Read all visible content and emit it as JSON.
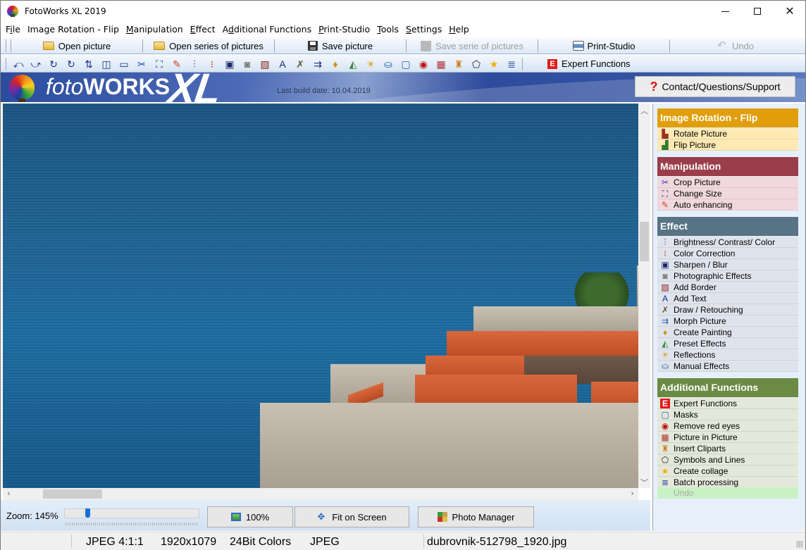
{
  "window": {
    "title": "FotoWorks XL 2019",
    "controls": {
      "minimize": "minimize",
      "maximize": "maximize",
      "close": "close"
    }
  },
  "menubar": {
    "items": [
      {
        "label": "File",
        "underline": "i"
      },
      {
        "label": "Image Rotation - Flip",
        "underline": "g"
      },
      {
        "label": "Manipulation",
        "underline": "M"
      },
      {
        "label": "Effect",
        "underline": "E"
      },
      {
        "label": "Additional Functions",
        "underline": "d"
      },
      {
        "label": "Print-Studio",
        "underline": "P"
      },
      {
        "label": "Tools",
        "underline": "T"
      },
      {
        "label": "Settings",
        "underline": "S"
      },
      {
        "label": "Help",
        "underline": "H"
      }
    ]
  },
  "toolbar": {
    "open_picture": "Open picture",
    "open_series": "Open series of pictures",
    "save_picture": "Save picture",
    "save_series": "Save serie of pictures",
    "print_studio": "Print-Studio",
    "undo": "Undo"
  },
  "icon_toolbar": {
    "icons": [
      "rotate-left-icon",
      "rotate-right-icon",
      "rotate-ccw-icon",
      "rotate-cw-icon",
      "flip-vertical-icon",
      "flip-horizontal-icon",
      "scan-icon",
      "crop-scissors-icon",
      "resize-icon",
      "magic-wand-icon",
      "brightness-sliders-icon",
      "color-correction-icon",
      "sharpen-blur-icon",
      "camera-effects-icon",
      "border-icon",
      "text-icon",
      "draw-retouch-icon",
      "morph-icon",
      "painting-pen-icon",
      "preset-effects-icon",
      "reflections-icon",
      "manual-effects-icon",
      "masks-icon",
      "red-eye-icon",
      "picture-in-picture-icon",
      "cliparts-icon",
      "symbols-lines-icon",
      "collage-star-icon",
      "batch-processing-icon"
    ],
    "expert_functions": "Expert Functions",
    "expert_badge": "E"
  },
  "brand": {
    "name_light": "foto",
    "name_bold": "WORKS",
    "suffix": "XL",
    "build_date": "Last build date: 10.04.2019",
    "support_button": "Contact/Questions/Support",
    "support_icon": "?"
  },
  "viewer": {
    "image_description": "Dubrovnik old town walls and orange roofs by the blue sea",
    "zoom_label": "Zoom: 145%",
    "zoom_percent": 145,
    "zoom_slider_fraction": 0.15,
    "btn_100": "100%",
    "btn_fit": "Fit on Screen",
    "btn_photo_manager": "Photo Manager"
  },
  "sidebar": {
    "groups": [
      {
        "title": "Image Rotation - Flip",
        "header_color": "#e19e0b",
        "item_color": "#fde9b3",
        "items": [
          {
            "label": "Rotate Picture",
            "icon": "rotate-picture-icon"
          },
          {
            "label": "Flip Picture",
            "icon": "flip-picture-icon"
          }
        ]
      },
      {
        "title": "Manipulation",
        "header_color": "#9b3e4b",
        "item_color": "#f0d8dc",
        "items": [
          {
            "label": "Crop Picture",
            "icon": "scissors-icon"
          },
          {
            "label": "Change Size",
            "icon": "resize-icon"
          },
          {
            "label": "Auto enhancing",
            "icon": "magic-wand-icon"
          }
        ]
      },
      {
        "title": "Effect",
        "header_color": "#587385",
        "item_color": "#dfe4ec",
        "items": [
          {
            "label": "Brightness/ Contrast/ Color",
            "icon": "brightness-icon"
          },
          {
            "label": "Color Correction",
            "icon": "color-correction-icon"
          },
          {
            "label": "Sharpen / Blur",
            "icon": "sharpen-icon"
          },
          {
            "label": "Photographic Effects",
            "icon": "camera-icon"
          },
          {
            "label": "Add Border",
            "icon": "border-icon"
          },
          {
            "label": "Add Text",
            "icon": "text-icon"
          },
          {
            "label": "Draw / Retouching",
            "icon": "draw-icon"
          },
          {
            "label": "Morph Picture",
            "icon": "morph-icon"
          },
          {
            "label": "Create Painting",
            "icon": "pen-nib-icon"
          },
          {
            "label": "Preset Effects",
            "icon": "preset-icon"
          },
          {
            "label": "Reflections",
            "icon": "reflections-icon"
          },
          {
            "label": "Manual Effects",
            "icon": "paint-bucket-icon"
          }
        ]
      },
      {
        "title": "Additional Functions",
        "header_color": "#6b8a44",
        "item_color": "#e3e8da",
        "items": [
          {
            "label": "Expert Functions",
            "icon": "expert-e-icon"
          },
          {
            "label": "Masks",
            "icon": "mask-icon"
          },
          {
            "label": "Remove red eyes",
            "icon": "red-eye-icon"
          },
          {
            "label": "Picture in Picture",
            "icon": "pip-icon"
          },
          {
            "label": "Insert Cliparts",
            "icon": "clipart-icon"
          },
          {
            "label": "Symbols and Lines",
            "icon": "shapes-icon"
          },
          {
            "label": "Create collage",
            "icon": "star-icon"
          },
          {
            "label": "Batch processing",
            "icon": "batch-icon"
          }
        ]
      }
    ],
    "undo": "Undo"
  },
  "statusbar": {
    "format": "JPEG  4:1:1",
    "dimensions": "1920x1079",
    "colors": "24Bit Colors",
    "type": "JPEG",
    "filename": "dubrovnik-512798_1920.jpg"
  }
}
